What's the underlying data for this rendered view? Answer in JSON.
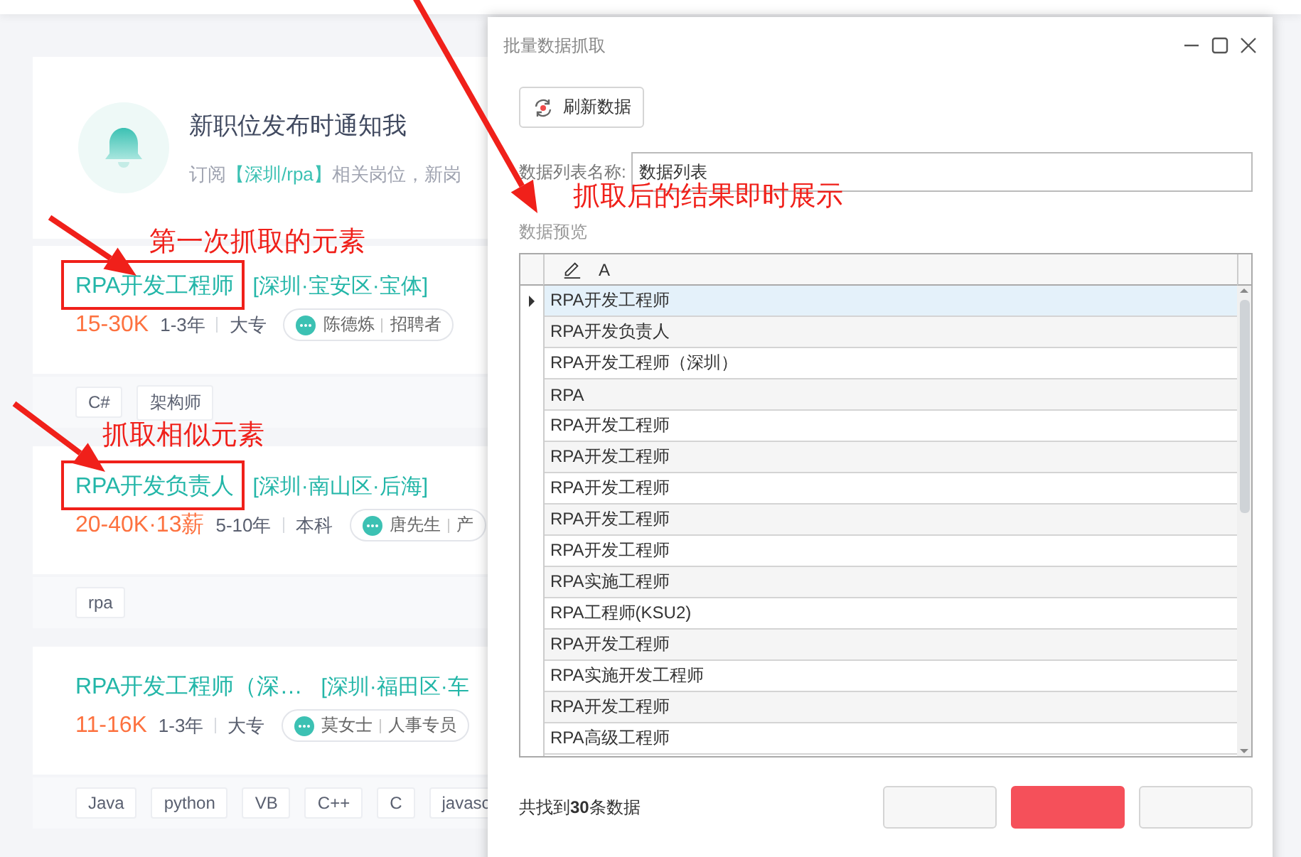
{
  "notice": {
    "title": "新职位发布时通知我",
    "subtitle": "订阅**【深圳/rpa】**相关岗位，新岗"
  },
  "jobs": [
    {
      "title": "RPA开发工程师",
      "location": "[深圳·宝安区·宝体]",
      "salary": "15-30K",
      "experience": "1-3年",
      "education": "大专",
      "recruiter": "陈德炼",
      "role": "招聘者",
      "tags": [
        "C#",
        "架构师"
      ],
      "marked": true
    },
    {
      "title": "RPA开发负责人",
      "location": "[深圳·南山区·后海]",
      "salary": "20-40K·13薪",
      "experience": "5-10年",
      "education": "本科",
      "recruiter": "唐先生",
      "role": "产",
      "tags": [
        "rpa"
      ],
      "marked": true
    },
    {
      "title": "RPA开发工程师（深…",
      "location": "[深圳·福田区·车",
      "salary": "11-16K",
      "experience": "1-3年",
      "education": "大专",
      "recruiter": "莫女士",
      "role": "人事专员",
      "tags": [
        "Java",
        "python",
        "VB",
        "C++",
        "C",
        "javasc"
      ],
      "marked": false
    }
  ],
  "annotations": [
    {
      "text": "第一次抓取的元素"
    },
    {
      "text": "抓取相似元素"
    },
    {
      "text": "抓取后的结果即时展示"
    }
  ],
  "dialog": {
    "title": "批量数据抓取",
    "refresh_button": "刷新数据",
    "list_name_label": "数据列表名称:",
    "list_name_value": "数据列表",
    "preview_label": "数据预览",
    "table": {
      "column": "A",
      "rows": [
        {
          "value": "RPA开发工程师",
          "selected": true
        },
        {
          "value": "RPA开发负责人",
          "selected": false
        },
        {
          "value": "RPA开发工程师（深圳）",
          "selected": false
        },
        {
          "value": "RPA",
          "selected": false
        },
        {
          "value": "RPA开发工程师",
          "selected": false
        },
        {
          "value": "RPA开发工程师",
          "selected": false
        },
        {
          "value": "RPA开发工程师",
          "selected": false
        },
        {
          "value": "RPA开发工程师",
          "selected": false
        },
        {
          "value": "RPA开发工程师",
          "selected": false
        },
        {
          "value": "RPA实施工程师",
          "selected": false
        },
        {
          "value": "RPA工程师(KSU2)",
          "selected": false
        },
        {
          "value": "RPA开发工程师",
          "selected": false
        },
        {
          "value": "RPA实施开发工程师",
          "selected": false
        },
        {
          "value": "RPA开发工程师",
          "selected": false
        },
        {
          "value": "RPA高级工程师",
          "selected": false
        }
      ]
    },
    "status": "共找到**30**条数据",
    "buttons": [
      {
        "kind": "plain"
      },
      {
        "kind": "primary"
      },
      {
        "kind": "plain"
      }
    ]
  }
}
